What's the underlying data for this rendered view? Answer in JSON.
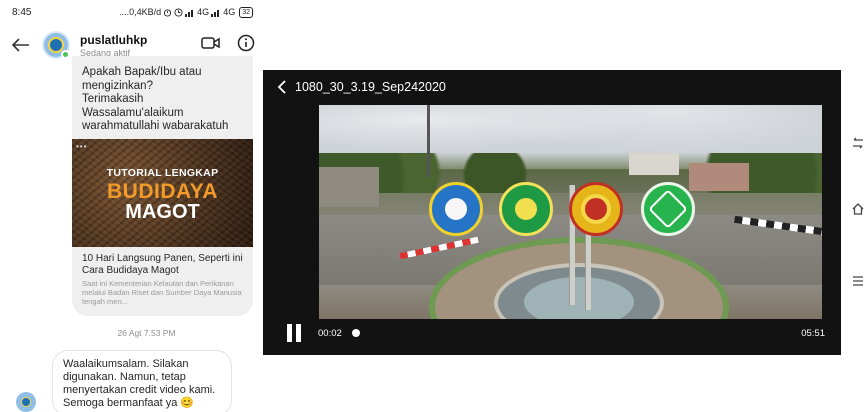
{
  "phone": {
    "status_bar": {
      "time": "8:45",
      "indicators": "....0,4KB/d",
      "network_1": "4G",
      "network_2": "4G",
      "battery": "32"
    },
    "chat_header": {
      "contact_name": "puslatluhkp",
      "contact_status": "Sedang aktif"
    },
    "messages": {
      "incoming_text": "Apakah Bapak/Ibu atau\nmengizinkan?\nTerimakasih\nWassalamu'alaikum\nwarahmatullahi wabarakatuh",
      "link_preview": {
        "thumbnail_dots": "•••",
        "thumb_line1": "TUTORIAL LENGKAP",
        "thumb_line2": "BUDIDAYA",
        "thumb_line3": "MAGOT",
        "title": "10 Hari Langsung Panen, Seperti ini Cara Budidaya Magot",
        "description": "Saat ini Kementerian Kelautan dan Perikanan melalui Badan Riset dan Sumber Daya Manusia tengah men..."
      },
      "timestamp": "26 Agt 7.53 PM",
      "reply_text": "Waalaikumsalam. Silakan\ndigunakan. Namun, tetap\nmenyertakan credit video kami.\nSemoga bermanfaat ya 😊"
    }
  },
  "player": {
    "title": "1080_30_3.19_Sep242020",
    "current_time": "00:02",
    "total_time": "05:51",
    "progress": 0.006
  },
  "icons": {
    "back": "arrow-left-icon",
    "video_call": "video-camera-icon",
    "info": "info-icon",
    "player_back": "chevron-left-icon",
    "pause": "pause-icon"
  },
  "colors": {
    "online": "#4cc45a",
    "player_bg": "#121212",
    "brand_orange": "#f29b2a"
  }
}
